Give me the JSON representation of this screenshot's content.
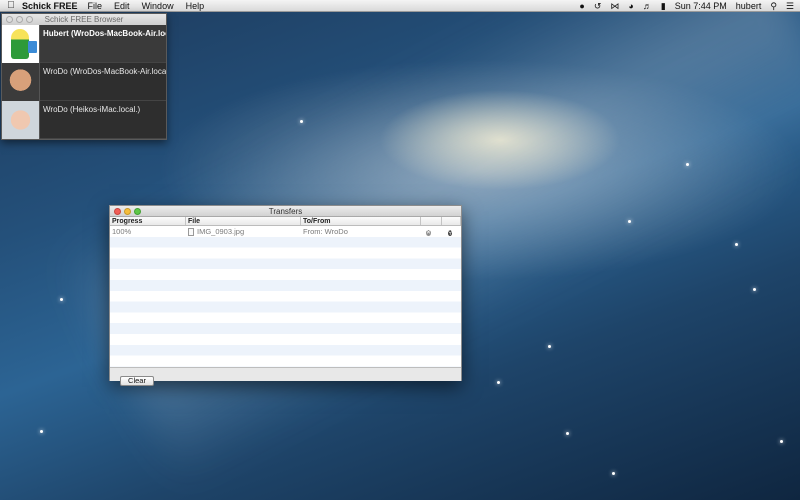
{
  "menubar": {
    "apple_icon": "apple-icon",
    "app_name": "Schick FREE",
    "menus": [
      "File",
      "Edit",
      "Window",
      "Help"
    ],
    "status_icons": [
      "notification-icon",
      "time-machine-icon",
      "bluetooth-icon",
      "wifi-icon",
      "volume-icon",
      "battery-icon"
    ],
    "clock": "Sun 7:44 PM",
    "user": "hubert"
  },
  "browser": {
    "title": "Schick FREE Browser",
    "peers": [
      {
        "name": "Hubert (WroDos-MacBook-Air.local)",
        "selected": true
      },
      {
        "name": "WroDo (WroDos-MacBook-Air.local)",
        "selected": false
      },
      {
        "name": "WroDo (Heikos-iMac.local.)",
        "selected": false
      }
    ]
  },
  "transfers": {
    "title": "Transfers",
    "columns": {
      "progress": "Progress",
      "file": "File",
      "tofrom": "To/From"
    },
    "rows": [
      {
        "progress": "100%",
        "file": "IMG_0903.jpg",
        "tofrom": "From: WroDo"
      }
    ],
    "clear_label": "Clear"
  },
  "colors": {
    "close": "#f25e57",
    "minimize": "#f6bd3b",
    "zoom": "#5fc747"
  }
}
